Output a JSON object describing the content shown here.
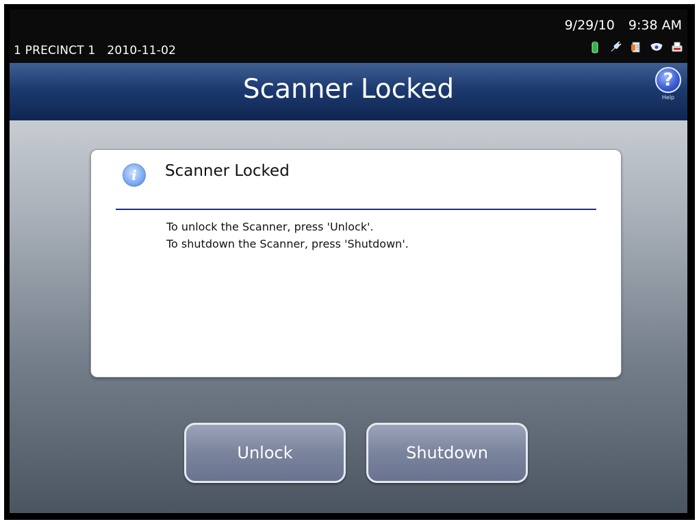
{
  "status": {
    "precinct": "1 PRECINCT 1",
    "election_date": "2010-11-02",
    "date": "9/29/10",
    "time": "9:38 AM",
    "icons": [
      "battery-icon",
      "power-plug-icon",
      "document-icon",
      "network-icon",
      "printer-icon"
    ]
  },
  "header": {
    "title": "Scanner Locked",
    "help_label": "Help",
    "help_glyph": "?"
  },
  "dialog": {
    "title": "Scanner Locked",
    "info_glyph": "i",
    "message_line1": "To unlock the Scanner, press 'Unlock'.",
    "message_line2": "To shutdown the Scanner, press 'Shutdown'."
  },
  "actions": {
    "unlock_label": "Unlock",
    "shutdown_label": "Shutdown"
  },
  "colors": {
    "title_bar": "#1c3a70",
    "rule": "#1e2f7a",
    "button": "#7a849c"
  }
}
